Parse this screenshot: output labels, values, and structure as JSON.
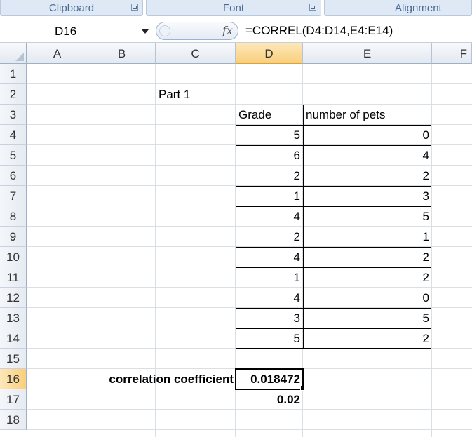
{
  "ribbon": {
    "groups": [
      "Clipboard",
      "Font",
      "Alignment"
    ]
  },
  "formula_bar": {
    "name_box": "D16",
    "fx_label": "fx",
    "formula": "=CORREL(D4:D14,E4:E14)"
  },
  "columns": [
    "A",
    "B",
    "C",
    "D",
    "E",
    "F"
  ],
  "rows": [
    "1",
    "2",
    "3",
    "4",
    "5",
    "6",
    "7",
    "8",
    "9",
    "10",
    "11",
    "12",
    "13",
    "14",
    "15",
    "16",
    "17",
    "18"
  ],
  "sheet": {
    "part_label": "Part 1",
    "table": {
      "headers": [
        "Grade",
        "number of pets"
      ],
      "grade": [
        "5",
        "6",
        "2",
        "1",
        "4",
        "2",
        "4",
        "1",
        "4",
        "3",
        "5"
      ],
      "pets": [
        "0",
        "4",
        "2",
        "3",
        "5",
        "1",
        "2",
        "2",
        "0",
        "5",
        "2"
      ]
    },
    "corr_label": "correlation coefficient",
    "corr_value": "0.018472",
    "corr_rounded": "0.02"
  },
  "selection": {
    "active_cell": "D16",
    "highlight_color": "#f9cf7c"
  }
}
